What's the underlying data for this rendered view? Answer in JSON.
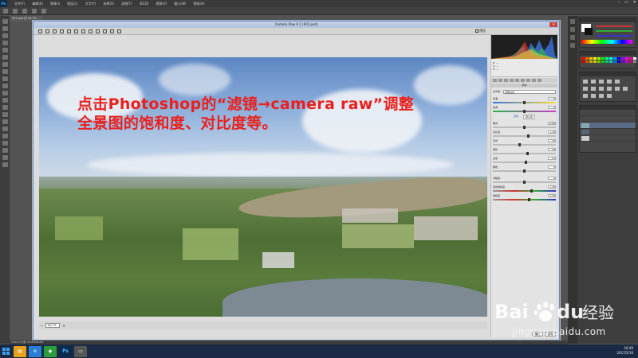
{
  "photoshop": {
    "logo": "Ps",
    "menu": [
      "文件(F)",
      "编辑(E)",
      "图像(I)",
      "图层(L)",
      "文字(Y)",
      "选择(S)",
      "滤镜(T)",
      "3D(D)",
      "视图(V)",
      "窗口(W)",
      "帮助(H)"
    ],
    "doc_tab": "001.psd @ 16.7%",
    "status": "16.67%   文档: 50.0M/50.0M"
  },
  "camera_raw": {
    "title": "Camera Raw 9.1 (001.psd)",
    "preview_label": "预览",
    "zoom_value": "16.7%",
    "wb_label": "白平衡:",
    "wb_value": "原照设置",
    "section_title": "基本",
    "auto_label": "自动",
    "default_label": "默认值",
    "sliders": [
      {
        "label": "色温",
        "value": "0",
        "pos": 0.5
      },
      {
        "label": "色调",
        "value": "0",
        "pos": 0.5
      },
      {
        "label": "曝光",
        "value": "0.00",
        "pos": 0.5
      },
      {
        "label": "对比度",
        "value": "+10",
        "pos": 0.56
      },
      {
        "label": "高光",
        "value": "-15",
        "pos": 0.42
      },
      {
        "label": "阴影",
        "value": "+8",
        "pos": 0.55
      },
      {
        "label": "白色",
        "value": "+5",
        "pos": 0.53
      },
      {
        "label": "黑色",
        "value": "0",
        "pos": 0.5
      },
      {
        "label": "清晰度",
        "value": "0",
        "pos": 0.5
      },
      {
        "label": "自然饱和度",
        "value": "+20",
        "pos": 0.62
      },
      {
        "label": "饱和度",
        "value": "+15",
        "pos": 0.58
      }
    ],
    "buttons": {
      "ok": "确定",
      "cancel": "取消"
    }
  },
  "overlay": {
    "line1": "点击Photoshop的“滤镜→camera raw”调整",
    "line2": "全景图的饱和度、对比度等。"
  },
  "watermark": {
    "brand": "Baidu经验",
    "url": "jingyan.baidu.com"
  },
  "taskbar": {
    "time": "16:40",
    "date": "2017/5/16"
  }
}
